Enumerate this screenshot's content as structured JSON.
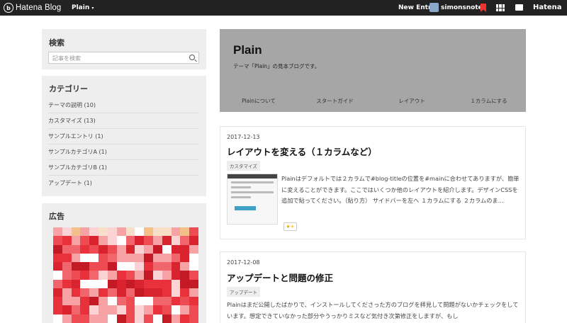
{
  "topbar": {
    "logo_text": "Hatena Blog",
    "blog_menu": "Plain",
    "new_entry": "New Entry",
    "username": "simonsnote",
    "hatena": "Hatena"
  },
  "sidebar": {
    "search": {
      "title": "検索",
      "placeholder": "記事を検索"
    },
    "categories": {
      "title": "カテゴリー",
      "items": [
        "テーマの説明 (10)",
        "カスタマイズ (13)",
        "サンプルエントリ (1)",
        "サンプルカテゴリA (1)",
        "サンプルカテゴリB (1)",
        "アップデート (1)"
      ]
    },
    "ad": {
      "title": "広告"
    }
  },
  "header": {
    "title": "Plain",
    "description": "テーマ「Plain」の見本ブログです。",
    "nav": [
      "Plainについて",
      "スタートガイド",
      "レイアウト",
      "１カラムにする"
    ]
  },
  "articles": [
    {
      "date": "2017-12-13",
      "title": "レイアウトを変える（１カラムなど）",
      "tag": "カスタマイズ",
      "body": "Plainはデフォルトでは２カラムで#blog-titleの位置を#mainに合わせてありますが、簡単に変えることができます。ここではいくつか他のレイアウトを紹介します。デザインCSSを追加で貼ってください。（貼り方） サイドバーを左へ １カラムにする ２カラムのま…",
      "star_label": "★+"
    },
    {
      "date": "2017-12-08",
      "title": "アップデートと問題の修正",
      "tag": "アップデート",
      "body": "Plainはまだ公開したばかりで、インストールしてくださった方のブログを拝見して問題がないかチェックをしています。想定できていなかった部分やうっかりミスなど気付き次第修正をしますが、もし"
    }
  ],
  "colors": {
    "topbar": "#222222",
    "header_bg": "#a6a6a6",
    "sidebox_bg": "#eeeeee",
    "bookmark_red": "#ee3333"
  }
}
